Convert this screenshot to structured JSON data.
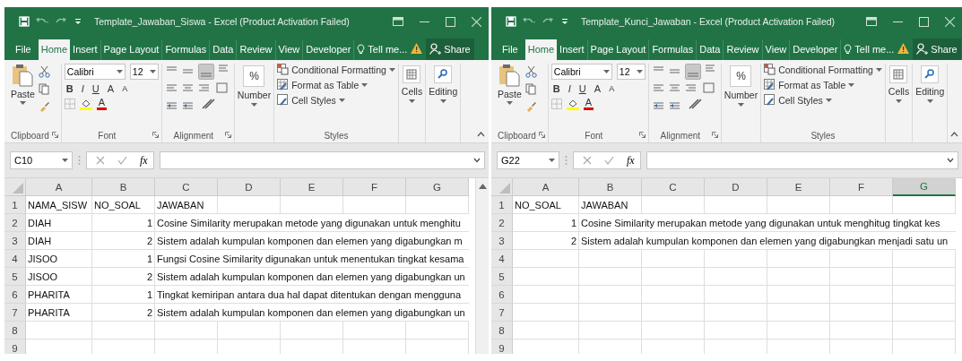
{
  "windows": [
    {
      "title": "Template_Jawaban_Siswa - Excel (Product Activation Failed)",
      "tabs": [
        {
          "label": "File",
          "selected": false
        },
        {
          "label": "Home",
          "selected": true
        },
        {
          "label": "Insert",
          "selected": false
        },
        {
          "label": "Page Layout",
          "selected": false
        },
        {
          "label": "Formulas",
          "selected": false
        },
        {
          "label": "Data",
          "selected": false
        },
        {
          "label": "Review",
          "selected": false
        },
        {
          "label": "View",
          "selected": false
        },
        {
          "label": "Developer",
          "selected": false
        }
      ],
      "tell_me": "Tell me...",
      "share": "Share",
      "ribbon": {
        "paste": "Paste",
        "clipboard": "Clipboard",
        "font_name": "Calibri",
        "font_size": "12",
        "bold": "B",
        "italic": "I",
        "underline": "U",
        "grow": "A",
        "shrink": "A",
        "font_color": "A",
        "font": "Font",
        "alignment": "Alignment",
        "percent": "%",
        "number": "Number",
        "conditional_formatting": "Conditional Formatting",
        "format_as_table": "Format as Table",
        "cell_styles": "Cell Styles",
        "styles": "Styles",
        "cells": "Cells",
        "editing": "Editing"
      },
      "name_box": "C10",
      "fx": "fx",
      "columns": [
        {
          "label": "A",
          "selected": false
        },
        {
          "label": "B",
          "selected": false
        },
        {
          "label": "C",
          "selected": false
        },
        {
          "label": "D",
          "selected": false
        },
        {
          "label": "E",
          "selected": false
        },
        {
          "label": "F",
          "selected": false
        },
        {
          "label": "G",
          "selected": false
        }
      ],
      "rows": [
        {
          "number": "1",
          "cells": [
            {
              "text": "NAMA_SISW",
              "kind": "text"
            },
            {
              "text": "NO_SOAL",
              "kind": "text"
            },
            {
              "text": "JAWABAN",
              "kind": "text"
            }
          ]
        },
        {
          "number": "2",
          "cells": [
            {
              "text": "DIAH",
              "kind": "text"
            },
            {
              "text": "1",
              "kind": "number"
            },
            {
              "text": "Cosine Similarity merupakan metode yang digunakan untuk menghitu",
              "kind": "overflow"
            }
          ]
        },
        {
          "number": "3",
          "cells": [
            {
              "text": "DIAH",
              "kind": "text"
            },
            {
              "text": "2",
              "kind": "number"
            },
            {
              "text": "Sistem adalah kumpulan komponen dan elemen yang digabungkan m",
              "kind": "overflow"
            }
          ]
        },
        {
          "number": "4",
          "cells": [
            {
              "text": "JISOO",
              "kind": "text"
            },
            {
              "text": "1",
              "kind": "number"
            },
            {
              "text": "Fungsi Cosine Similarity digunakan untuk menentukan tingkat kesama",
              "kind": "overflow"
            }
          ]
        },
        {
          "number": "5",
          "cells": [
            {
              "text": "JISOO",
              "kind": "text"
            },
            {
              "text": "2",
              "kind": "number"
            },
            {
              "text": "Sistem adalah kumpulan komponen dan elemen yang digabungkan un",
              "kind": "overflow"
            }
          ]
        },
        {
          "number": "6",
          "cells": [
            {
              "text": "PHARITA",
              "kind": "text"
            },
            {
              "text": "1",
              "kind": "number"
            },
            {
              "text": "Tingkat kemiripan antara dua hal dapat ditentukan dengan mengguna",
              "kind": "overflow"
            }
          ]
        },
        {
          "number": "7",
          "cells": [
            {
              "text": "PHARITA",
              "kind": "text"
            },
            {
              "text": "2",
              "kind": "number"
            },
            {
              "text": "Sistem adalah kumpulan komponen dan elemen yang digabungkan un",
              "kind": "overflow"
            }
          ]
        },
        {
          "number": "8",
          "cells": []
        },
        {
          "number": "9",
          "cells": []
        }
      ]
    },
    {
      "title": "Template_Kunci_Jawaban - Excel (Product Activation Failed)",
      "tabs": [
        {
          "label": "File",
          "selected": false
        },
        {
          "label": "Home",
          "selected": true
        },
        {
          "label": "Insert",
          "selected": false
        },
        {
          "label": "Page Layout",
          "selected": false
        },
        {
          "label": "Formulas",
          "selected": false
        },
        {
          "label": "Data",
          "selected": false
        },
        {
          "label": "Review",
          "selected": false
        },
        {
          "label": "View",
          "selected": false
        },
        {
          "label": "Developer",
          "selected": false
        }
      ],
      "tell_me": "Tell me...",
      "share": "Share",
      "ribbon": {
        "paste": "Paste",
        "clipboard": "Clipboard",
        "font_name": "Calibri",
        "font_size": "12",
        "bold": "B",
        "italic": "I",
        "underline": "U",
        "grow": "A",
        "shrink": "A",
        "font_color": "A",
        "font": "Font",
        "alignment": "Alignment",
        "percent": "%",
        "number": "Number",
        "conditional_formatting": "Conditional Formatting",
        "format_as_table": "Format as Table",
        "cell_styles": "Cell Styles",
        "styles": "Styles",
        "cells": "Cells",
        "editing": "Editing"
      },
      "name_box": "G22",
      "fx": "fx",
      "columns": [
        {
          "label": "A",
          "selected": false
        },
        {
          "label": "B",
          "selected": false
        },
        {
          "label": "C",
          "selected": false
        },
        {
          "label": "D",
          "selected": false
        },
        {
          "label": "E",
          "selected": false
        },
        {
          "label": "F",
          "selected": false
        },
        {
          "label": "G",
          "selected": true
        }
      ],
      "rows": [
        {
          "number": "1",
          "cells": [
            {
              "text": "NO_SOAL",
              "kind": "text"
            },
            {
              "text": "JAWABAN",
              "kind": "text"
            }
          ]
        },
        {
          "number": "2",
          "cells": [
            {
              "text": "1",
              "kind": "number"
            },
            {
              "text": "Cosine Similarity merupakan metode yang digunakan untuk menghitug tingkat kes",
              "kind": "overflow"
            }
          ]
        },
        {
          "number": "3",
          "cells": [
            {
              "text": "2",
              "kind": "number"
            },
            {
              "text": "Sistem adalah kumpulan komponen dan elemen yang digabungkan menjadi satu un",
              "kind": "overflow"
            }
          ]
        },
        {
          "number": "4",
          "cells": []
        },
        {
          "number": "5",
          "cells": []
        },
        {
          "number": "6",
          "cells": []
        },
        {
          "number": "7",
          "cells": []
        },
        {
          "number": "8",
          "cells": []
        },
        {
          "number": "9",
          "cells": []
        }
      ]
    }
  ]
}
